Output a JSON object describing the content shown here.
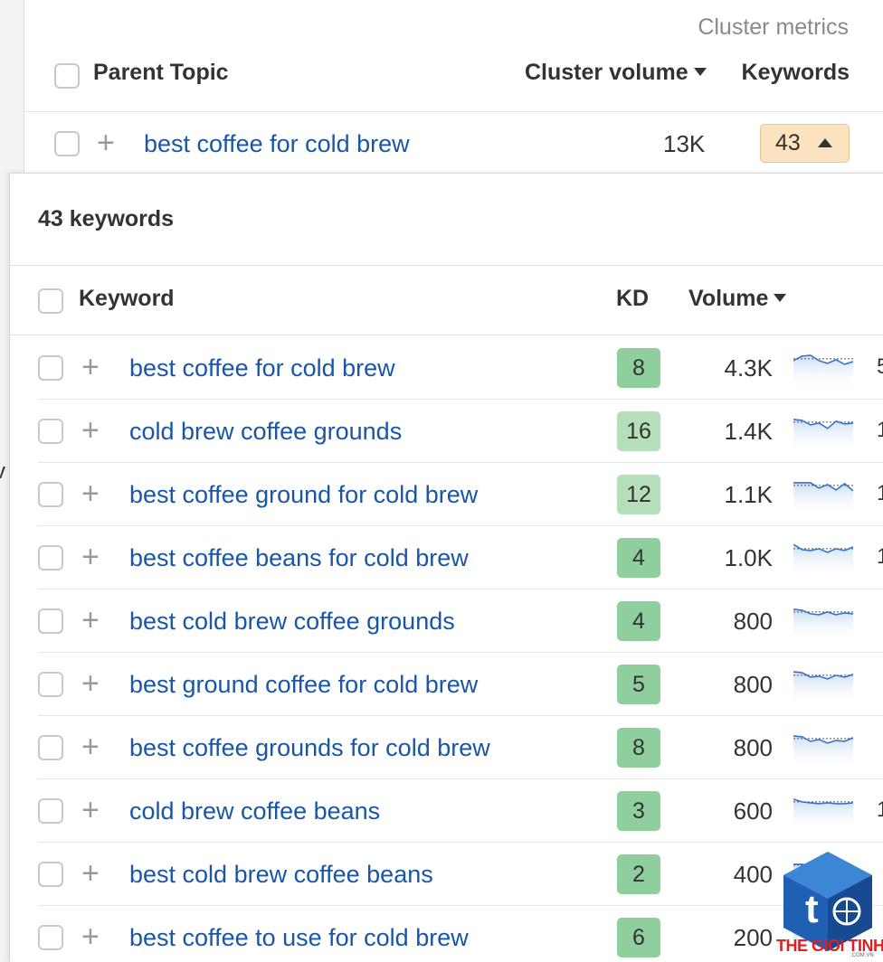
{
  "header": {
    "section_label": "Cluster metrics",
    "parent_topic_label": "Parent Topic",
    "cluster_volume_label": "Cluster volume",
    "keywords_label": "Keywords"
  },
  "topic": {
    "name": "best coffee for cold brew",
    "cluster_volume": "13K",
    "keyword_count": "43"
  },
  "popup": {
    "title": "43 keywords",
    "col_keyword": "Keyword",
    "col_kd": "KD",
    "col_volume": "Volume"
  },
  "rows": [
    {
      "keyword": "best coffee for cold brew",
      "kd": "8",
      "kd_color": "#8fcf9e",
      "volume": "4.3K",
      "cut": "5",
      "trend": [
        0.55,
        0.3,
        0.25,
        0.55,
        0.7,
        0.5,
        0.75,
        0.6
      ]
    },
    {
      "keyword": "cold brew coffee grounds",
      "kd": "16",
      "kd_color": "#b4dfb9",
      "volume": "1.4K",
      "cut": "1",
      "trend": [
        0.3,
        0.35,
        0.6,
        0.5,
        0.8,
        0.4,
        0.55,
        0.5
      ]
    },
    {
      "keyword": "best coffee ground for cold brew",
      "kd": "12",
      "kd_color": "#b4dfb9",
      "volume": "1.1K",
      "cut": "1",
      "trend": [
        0.3,
        0.3,
        0.3,
        0.6,
        0.4,
        0.7,
        0.35,
        0.75
      ]
    },
    {
      "keyword": "best coffee beans for cold brew",
      "kd": "4",
      "kd_color": "#8fcf9e",
      "volume": "1.0K",
      "cut": "1",
      "trend": [
        0.2,
        0.5,
        0.55,
        0.45,
        0.65,
        0.45,
        0.55,
        0.35
      ]
    },
    {
      "keyword": "best cold brew coffee grounds",
      "kd": "4",
      "kd_color": "#8fcf9e",
      "volume": "800",
      "cut": "",
      "trend": [
        0.3,
        0.35,
        0.55,
        0.6,
        0.45,
        0.6,
        0.5,
        0.55
      ]
    },
    {
      "keyword": "best ground coffee for cold brew",
      "kd": "5",
      "kd_color": "#8fcf9e",
      "volume": "800",
      "cut": "",
      "trend": [
        0.25,
        0.3,
        0.55,
        0.5,
        0.65,
        0.45,
        0.55,
        0.4
      ]
    },
    {
      "keyword": "best coffee grounds for cold brew",
      "kd": "8",
      "kd_color": "#8fcf9e",
      "volume": "800",
      "cut": "",
      "trend": [
        0.3,
        0.35,
        0.6,
        0.5,
        0.7,
        0.55,
        0.6,
        0.4
      ]
    },
    {
      "keyword": "cold brew coffee beans",
      "kd": "3",
      "kd_color": "#8fcf9e",
      "volume": "600",
      "cut": "1",
      "trend": [
        0.3,
        0.45,
        0.5,
        0.55,
        0.5,
        0.55,
        0.55,
        0.5
      ]
    },
    {
      "keyword": "best cold brew coffee beans",
      "kd": "2",
      "kd_color": "#8fcf9e",
      "volume": "400",
      "cut": "",
      "trend": [
        0.4,
        0.4,
        0.45,
        0.5,
        0.45,
        0.5,
        0.45,
        0.5
      ]
    },
    {
      "keyword": "best coffee to use for cold brew",
      "kd": "6",
      "kd_color": "#8fcf9e",
      "volume": "200",
      "cut": "",
      "trend": [
        0.4,
        0.45,
        0.5,
        0.45,
        0.5,
        0.5,
        0.45,
        0.5
      ]
    }
  ],
  "watermark": {
    "brand": "THE GIOI TINHOC",
    "domain": ".COM.VN"
  }
}
